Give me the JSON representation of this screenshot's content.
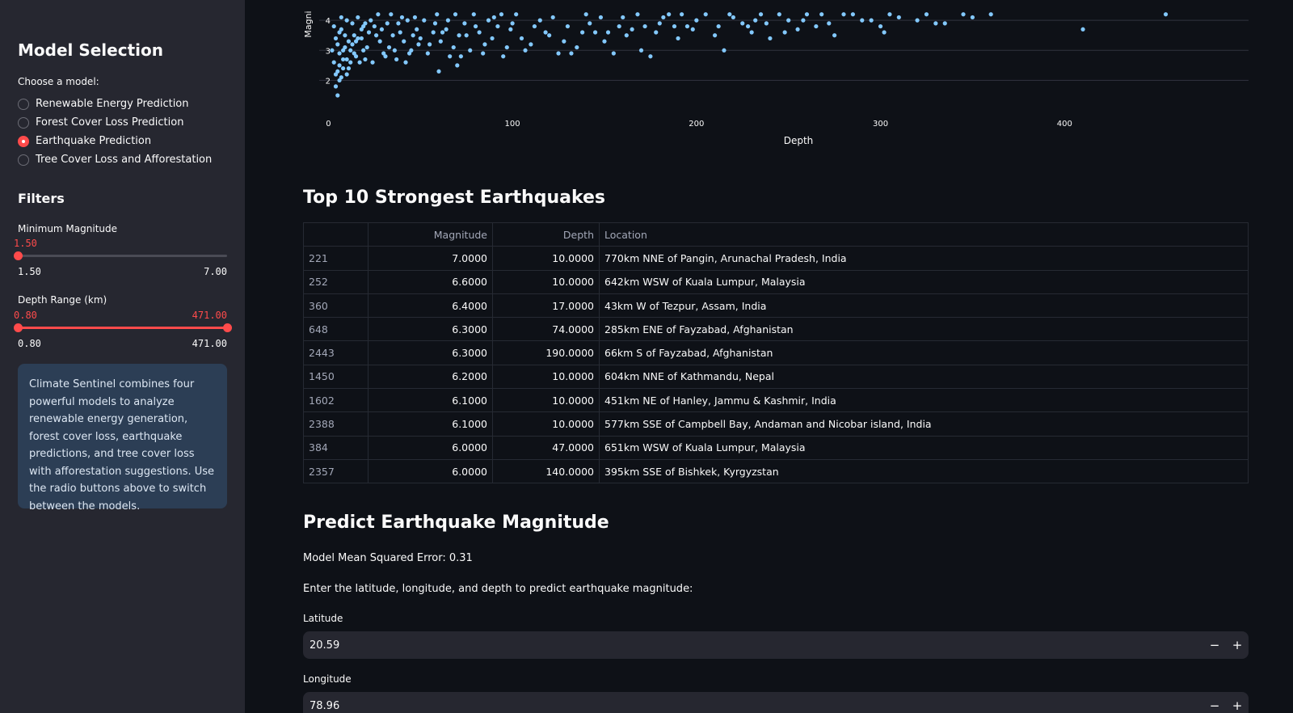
{
  "sidebar": {
    "title": "Model Selection",
    "choose_label": "Choose a model:",
    "models": [
      {
        "label": "Renewable Energy Prediction",
        "selected": false
      },
      {
        "label": "Forest Cover Loss Prediction",
        "selected": false
      },
      {
        "label": "Earthquake Prediction",
        "selected": true
      },
      {
        "label": "Tree Cover Loss and Afforestation",
        "selected": false
      }
    ],
    "filters_title": "Filters",
    "min_magnitude": {
      "label": "Minimum Magnitude",
      "value": "1.50",
      "min": "1.50",
      "max": "7.00",
      "fraction": 0.0
    },
    "depth_range": {
      "label": "Depth Range (km)",
      "low": "0.80",
      "high": "471.00",
      "min": "0.80",
      "max": "471.00",
      "low_fraction": 0.0,
      "high_fraction": 1.0
    },
    "info": "Climate Sentinel combines four powerful models to analyze renewable energy generation, forest cover loss, earthquake predictions, and tree cover loss with afforestation suggestions. Use the radio buttons above to switch between the models."
  },
  "chart_data": {
    "type": "scatter",
    "xlabel": "Depth",
    "ylabel": "Magni",
    "x_ticks": [
      "0",
      "100",
      "200",
      "300",
      "400"
    ],
    "y_ticks": [
      "2",
      "3",
      "4"
    ],
    "xlim": [
      -5,
      500
    ],
    "ylim": [
      1.5,
      4.3
    ],
    "point_color": "#83c9ff",
    "points": [
      [
        5,
        1.5
      ],
      [
        4,
        1.8
      ],
      [
        6,
        2.0
      ],
      [
        7,
        2.1
      ],
      [
        5,
        2.3
      ],
      [
        8,
        2.4
      ],
      [
        10,
        2.2
      ],
      [
        12,
        2.6
      ],
      [
        15,
        2.8
      ],
      [
        6,
        2.9
      ],
      [
        9,
        3.1
      ],
      [
        11,
        3.3
      ],
      [
        14,
        3.5
      ],
      [
        18,
        3.7
      ],
      [
        20,
        3.9
      ],
      [
        7,
        4.1
      ],
      [
        3,
        3.8
      ],
      [
        4,
        3.4
      ],
      [
        6,
        3.6
      ],
      [
        8,
        3.0
      ],
      [
        10,
        2.7
      ],
      [
        13,
        3.2
      ],
      [
        16,
        3.4
      ],
      [
        19,
        3.0
      ],
      [
        22,
        3.6
      ],
      [
        25,
        3.8
      ],
      [
        28,
        3.3
      ],
      [
        30,
        2.9
      ],
      [
        33,
        3.1
      ],
      [
        35,
        3.5
      ],
      [
        38,
        3.9
      ],
      [
        40,
        4.1
      ],
      [
        42,
        2.6
      ],
      [
        45,
        3.0
      ],
      [
        48,
        3.7
      ],
      [
        50,
        3.4
      ],
      [
        55,
        3.2
      ],
      [
        58,
        3.9
      ],
      [
        60,
        2.3
      ],
      [
        62,
        3.6
      ],
      [
        65,
        4.0
      ],
      [
        68,
        3.1
      ],
      [
        70,
        2.5
      ],
      [
        72,
        2.8
      ],
      [
        75,
        3.5
      ],
      [
        80,
        3.8
      ],
      [
        85,
        3.2
      ],
      [
        90,
        4.1
      ],
      [
        95,
        2.8
      ],
      [
        100,
        3.9
      ],
      [
        105,
        3.4
      ],
      [
        110,
        3.2
      ],
      [
        115,
        4.0
      ],
      [
        120,
        3.5
      ],
      [
        125,
        2.9
      ],
      [
        130,
        3.8
      ],
      [
        135,
        3.1
      ],
      [
        140,
        4.2
      ],
      [
        145,
        3.6
      ],
      [
        150,
        3.3
      ],
      [
        155,
        2.9
      ],
      [
        160,
        4.1
      ],
      [
        165,
        3.7
      ],
      [
        170,
        3.0
      ],
      [
        175,
        2.8
      ],
      [
        180,
        3.9
      ],
      [
        185,
        4.2
      ],
      [
        190,
        3.4
      ],
      [
        195,
        3.8
      ],
      [
        200,
        4.0
      ],
      [
        210,
        3.5
      ],
      [
        215,
        3.0
      ],
      [
        220,
        4.1
      ],
      [
        225,
        3.9
      ],
      [
        230,
        3.6
      ],
      [
        235,
        4.2
      ],
      [
        240,
        3.4
      ],
      [
        250,
        4.0
      ],
      [
        255,
        3.7
      ],
      [
        260,
        4.2
      ],
      [
        265,
        3.8
      ],
      [
        275,
        3.5
      ],
      [
        280,
        4.2
      ],
      [
        290,
        4.0
      ],
      [
        300,
        3.8
      ],
      [
        302,
        3.6
      ],
      [
        305,
        4.2
      ],
      [
        320,
        4.0
      ],
      [
        330,
        3.9
      ],
      [
        350,
        4.1
      ],
      [
        360,
        4.2
      ],
      [
        410,
        3.7
      ],
      [
        455,
        4.2
      ],
      [
        2,
        3.0
      ],
      [
        3,
        2.6
      ],
      [
        4,
        2.2
      ],
      [
        5,
        3.2
      ],
      [
        6,
        2.5
      ],
      [
        7,
        3.7
      ],
      [
        8,
        2.7
      ],
      [
        9,
        3.5
      ],
      [
        10,
        4.0
      ],
      [
        11,
        2.4
      ],
      [
        12,
        3.0
      ],
      [
        13,
        3.9
      ],
      [
        14,
        2.9
      ],
      [
        15,
        3.3
      ],
      [
        16,
        4.1
      ],
      [
        17,
        2.6
      ],
      [
        18,
        3.4
      ],
      [
        19,
        3.8
      ],
      [
        20,
        2.7
      ],
      [
        21,
        3.1
      ],
      [
        23,
        4.0
      ],
      [
        24,
        2.6
      ],
      [
        26,
        3.5
      ],
      [
        27,
        4.2
      ],
      [
        29,
        3.7
      ],
      [
        31,
        2.8
      ],
      [
        32,
        3.9
      ],
      [
        34,
        4.2
      ],
      [
        36,
        3.0
      ],
      [
        37,
        2.7
      ],
      [
        39,
        3.6
      ],
      [
        41,
        3.3
      ],
      [
        43,
        4.0
      ],
      [
        44,
        2.9
      ],
      [
        46,
        3.5
      ],
      [
        47,
        4.1
      ],
      [
        49,
        3.2
      ],
      [
        52,
        4.0
      ],
      [
        54,
        2.9
      ],
      [
        57,
        3.6
      ],
      [
        59,
        4.2
      ],
      [
        61,
        3.3
      ],
      [
        64,
        3.7
      ],
      [
        66,
        2.8
      ],
      [
        69,
        4.2
      ],
      [
        71,
        3.5
      ],
      [
        74,
        3.9
      ],
      [
        77,
        3.0
      ],
      [
        79,
        4.2
      ],
      [
        82,
        3.6
      ],
      [
        84,
        2.9
      ],
      [
        87,
        4.0
      ],
      [
        89,
        3.4
      ],
      [
        92,
        3.8
      ],
      [
        94,
        4.2
      ],
      [
        97,
        3.1
      ],
      [
        99,
        3.7
      ],
      [
        102,
        4.2
      ],
      [
        107,
        3.0
      ],
      [
        112,
        3.8
      ],
      [
        118,
        3.6
      ],
      [
        122,
        4.1
      ],
      [
        128,
        3.3
      ],
      [
        132,
        2.9
      ],
      [
        138,
        3.6
      ],
      [
        142,
        3.9
      ],
      [
        148,
        4.1
      ],
      [
        152,
        3.6
      ],
      [
        158,
        3.8
      ],
      [
        162,
        3.5
      ],
      [
        168,
        4.2
      ],
      [
        172,
        3.8
      ],
      [
        178,
        3.6
      ],
      [
        182,
        4.1
      ],
      [
        188,
        3.8
      ],
      [
        192,
        4.2
      ],
      [
        198,
        3.7
      ],
      [
        205,
        4.2
      ],
      [
        212,
        3.8
      ],
      [
        218,
        4.2
      ],
      [
        228,
        3.8
      ],
      [
        232,
        4.0
      ],
      [
        238,
        3.9
      ],
      [
        245,
        4.2
      ],
      [
        248,
        3.6
      ],
      [
        258,
        4.0
      ],
      [
        268,
        4.2
      ],
      [
        272,
        3.9
      ],
      [
        285,
        4.2
      ],
      [
        295,
        4.0
      ],
      [
        310,
        4.1
      ],
      [
        325,
        4.2
      ],
      [
        335,
        3.9
      ],
      [
        345,
        4.2
      ]
    ]
  },
  "top10": {
    "title": "Top 10 Strongest Earthquakes",
    "columns": [
      "",
      "Magnitude",
      "Depth",
      "Location"
    ],
    "rows": [
      [
        "221",
        "7.0000",
        "10.0000",
        "770km NNE of Pangin, Arunachal Pradesh, India"
      ],
      [
        "252",
        "6.6000",
        "10.0000",
        "642km WSW of Kuala Lumpur, Malaysia"
      ],
      [
        "360",
        "6.4000",
        "17.0000",
        "43km W of Tezpur, Assam, India"
      ],
      [
        "648",
        "6.3000",
        "74.0000",
        "285km ENE of Fayzabad, Afghanistan"
      ],
      [
        "2443",
        "6.3000",
        "190.0000",
        "66km S of Fayzabad, Afghanistan"
      ],
      [
        "1450",
        "6.2000",
        "10.0000",
        "604km NNE of Kathmandu, Nepal"
      ],
      [
        "1602",
        "6.1000",
        "10.0000",
        "451km NE of Hanley, Jammu & Kashmir, India"
      ],
      [
        "2388",
        "6.1000",
        "10.0000",
        "577km SSE of Campbell Bay, Andaman and Nicobar island, India"
      ],
      [
        "384",
        "6.0000",
        "47.0000",
        "651km WSW of Kuala Lumpur, Malaysia"
      ],
      [
        "2357",
        "6.0000",
        "140.0000",
        "395km SSE of Bishkek, Kyrgyzstan"
      ]
    ]
  },
  "predict": {
    "title": "Predict Earthquake Magnitude",
    "mse_text": "Model Mean Squared Error: 0.31",
    "instruction": "Enter the latitude, longitude, and depth to predict earthquake magnitude:",
    "latitude_label": "Latitude",
    "latitude_value": "20.59",
    "longitude_label": "Longitude",
    "longitude_value": "78.96",
    "minus": "−",
    "plus": "+"
  }
}
